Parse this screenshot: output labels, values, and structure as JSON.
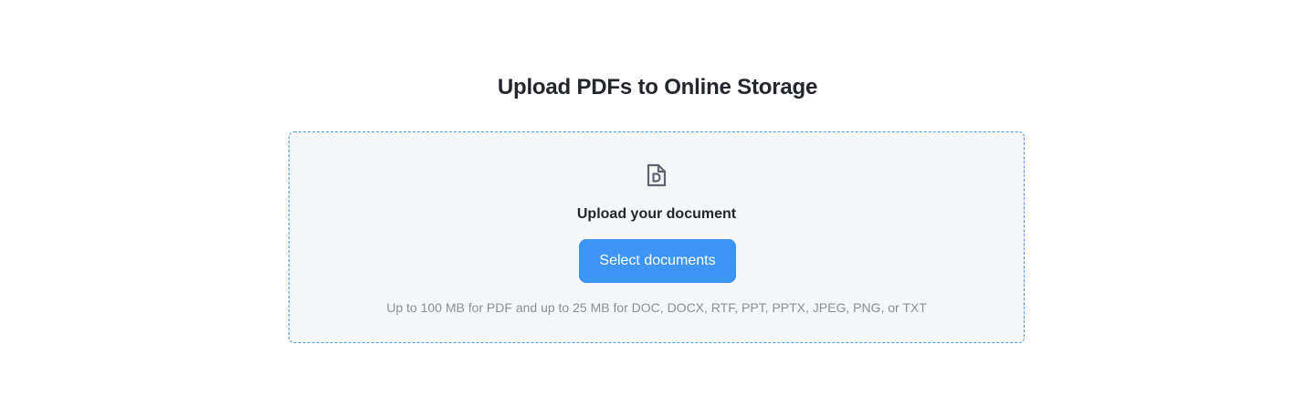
{
  "page": {
    "title": "Upload PDFs to Online Storage"
  },
  "dropzone": {
    "icon": "document-icon",
    "heading": "Upload your document",
    "button_label": "Select documents",
    "hint": "Up to 100 MB for PDF and up to 25 MB for DOC, DOCX, RTF, PPT, PPTX, JPEG, PNG, or TXT"
  },
  "colors": {
    "accent": "#3d95f5",
    "dropzone_border": "#4a9be8",
    "dropzone_background": "#f6f7f9",
    "title_text": "#23262d",
    "hint_text": "#8a8f98",
    "icon": "#5f6470"
  }
}
